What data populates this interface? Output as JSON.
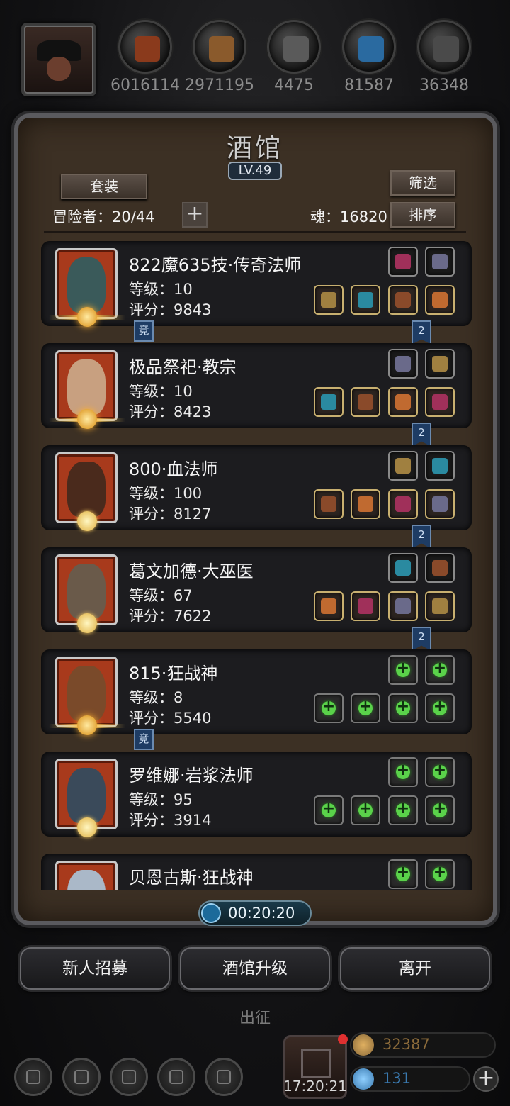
{
  "resources": [
    {
      "name": "meat-icon",
      "value": "6016114",
      "color": "#8a3a1c"
    },
    {
      "name": "wood-icon",
      "value": "2971195",
      "color": "#8a5a2c"
    },
    {
      "name": "iron-icon",
      "value": "4475",
      "color": "#5a5a5a"
    },
    {
      "name": "crystal-icon",
      "value": "81587",
      "color": "#2a6aa0"
    },
    {
      "name": "stone-icon",
      "value": "36348",
      "color": "#4a4a4a"
    }
  ],
  "panel": {
    "title": "酒馆",
    "level": "LV.49",
    "suit_button": "套装",
    "filter_button": "筛选",
    "sort_button": "排序",
    "adventurers_label": "冒险者：20/44",
    "soul_label": "魂：16820"
  },
  "heroes": [
    {
      "name": "822魔635技·传奇法师",
      "level": "等级：10",
      "score": "评分：9843",
      "face": "#3a5a5a",
      "medal": "gold",
      "tags": [
        "竞",
        "2"
      ]
    },
    {
      "name": "极品祭祀·教宗",
      "level": "等级：10",
      "score": "评分：8423",
      "face": "#c8a080",
      "medal": "gold",
      "tags": [
        "",
        "2"
      ]
    },
    {
      "name": "800·血法师",
      "level": "等级：100",
      "score": "评分：8127",
      "face": "#4a2a1c",
      "medal": "moon",
      "tags": [
        "",
        "2"
      ]
    },
    {
      "name": "葛文加德·大巫医",
      "level": "等级：67",
      "score": "评分：7622",
      "face": "#6a5a4a",
      "medal": "moon",
      "tags": [
        "",
        "2"
      ]
    },
    {
      "name": "815·狂战神",
      "level": "等级：8",
      "score": "评分：5540",
      "face": "#7a4a2a",
      "medal": "gold",
      "tags": [
        "竞",
        ""
      ]
    },
    {
      "name": "罗维娜·岩浆法师",
      "level": "等级：95",
      "score": "评分：3914",
      "face": "#3a4a5a",
      "medal": "moon",
      "tags": [
        "",
        ""
      ]
    },
    {
      "name": "贝恩古斯·狂战神",
      "level": "",
      "score": "",
      "face": "#aab8c8",
      "medal": "none",
      "tags": [
        "",
        ""
      ]
    }
  ],
  "equipment": [
    {
      "top": [
        "boots-icon",
        "amulet-icon"
      ],
      "bottom": [
        "staff-icon",
        "armor-icon",
        "gem-icon",
        "ring-icon"
      ],
      "empty": false
    },
    {
      "top": [
        "tome-icon",
        "amulet-icon"
      ],
      "bottom": [
        "hammer-icon",
        "robe-icon",
        "shield-icon",
        "bracer-icon"
      ],
      "empty": false
    },
    {
      "top": [
        "feather-icon",
        "wings-icon"
      ],
      "bottom": [
        "wand-icon",
        "cloak-icon",
        "scroll-icon",
        "scroll-icon"
      ],
      "empty": false
    },
    {
      "top": [
        "talisman-icon",
        "dagger-icon"
      ],
      "bottom": [
        "spear-icon",
        "mask-icon",
        "orb-icon",
        "herb-icon"
      ],
      "empty": false
    },
    {
      "top": [
        "add-slot-icon",
        "add-slot-icon"
      ],
      "bottom": [
        "add-slot-icon",
        "add-slot-icon",
        "add-slot-icon",
        "add-slot-icon"
      ],
      "empty": true
    },
    {
      "top": [
        "add-slot-icon",
        "add-slot-icon"
      ],
      "bottom": [
        "add-slot-icon",
        "add-slot-icon",
        "add-slot-icon",
        "add-slot-icon"
      ],
      "empty": true
    },
    {
      "top": [
        "add-slot-icon",
        "add-slot-icon"
      ],
      "bottom": [],
      "empty": true
    }
  ],
  "timer": "00:20:20",
  "buttons": {
    "recruit": "新人招募",
    "upgrade": "酒馆升级",
    "leave": "离开"
  },
  "sortie_label": "出征",
  "gift_timer": "17:20:21",
  "currency": {
    "gold": "32387",
    "gem": "131",
    "gold_color": "#8a6a3a",
    "gem_color": "#3a7ab0"
  },
  "nav_icons": [
    "settings-icon",
    "achievement-icon",
    "guild-icon",
    "mail-icon",
    "hero-icon"
  ]
}
